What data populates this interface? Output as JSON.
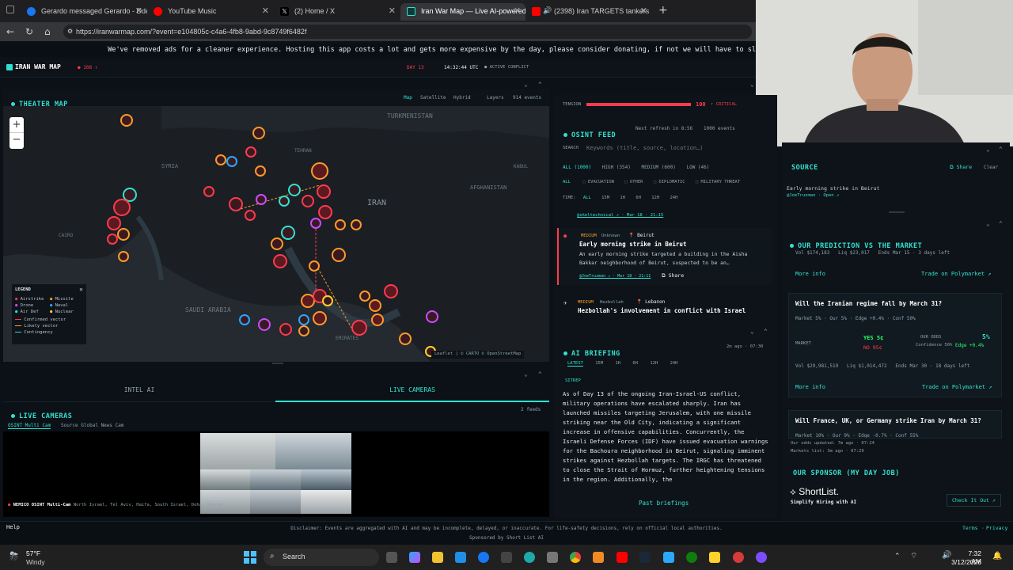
{
  "browser": {
    "tabs": [
      {
        "label": "Gerardo messaged Gerardo - Dde",
        "color": "#1877f2"
      },
      {
        "label": "YouTube Music",
        "color": "#ff0000"
      },
      {
        "label": "(2) Home / X",
        "color": "#e7e9ea"
      },
      {
        "label": "Iran War Map — Live AI-powered",
        "color": "#33e0d0"
      },
      {
        "label": "(2398) Iran TARGETS tankers",
        "color": "#ff0000"
      }
    ],
    "url": "https://iranwarmap.com/?event=e104805c-c4a6-4fb8-9abd-9c8749f6482f"
  },
  "banner": "We've removed ads for a cleaner experience. Hosting this app costs a lot and gets more expensive by the day, please consider donating, if not we will have to sl",
  "header": {
    "logo": "IRAN WAR MAP",
    "count": "108",
    "day": "DAY 13",
    "time": "14:32:44 UTC",
    "status": "ACTIVE CONFLICT"
  },
  "map": {
    "title": "THEATER MAP",
    "view_tabs": [
      "Map",
      "Satellite",
      "Hybrid"
    ],
    "layers": "Layers",
    "events": "914 events",
    "labels": [
      "TURKMENISTAN",
      "SYRIA",
      "IRAN",
      "AFGHANISTAN",
      "SAUDI ARABIA",
      "KABUL",
      "CAIRO",
      "EMIRATES",
      "TEHRAN"
    ],
    "attribution": "Leaflet | © CARTO © OpenStreetMap",
    "zoom_in": "+",
    "zoom_out": "−"
  },
  "legend": {
    "title": "LEGEND",
    "items": [
      {
        "label": "Airstrike",
        "color": "#ff3a4f"
      },
      {
        "label": "Missile",
        "color": "#ff9a2a"
      },
      {
        "label": "Drone",
        "color": "#c94dff"
      },
      {
        "label": "Naval",
        "color": "#2aa8ff"
      },
      {
        "label": "Air Def",
        "color": "#33e0d0"
      },
      {
        "label": "Nuclear",
        "color": "#ffd12a"
      }
    ],
    "vectors": [
      {
        "label": "Confirmed vector",
        "color": "#ff3a4f"
      },
      {
        "label": "Likely vector",
        "color": "#ff9a2a"
      },
      {
        "label": "Contingency",
        "color": "#33e0d0"
      }
    ]
  },
  "tension": {
    "label": "TENSION",
    "value": "100",
    "status": "CRITICAL",
    "level": 1.0
  },
  "feed": {
    "title": "OSINT FEED",
    "refresh": "Next refresh in 8:56",
    "count": "1000 events",
    "search_label": "SEARCH",
    "search_placeholder": "Keywords (title, source, location…)",
    "filters": [
      "ALL (1000)",
      "HIGH (354)",
      "MEDIUM (600)",
      "LOW (46)"
    ],
    "cats": [
      "ALL",
      "EVACUATION",
      "OTHER",
      "DIPLOMATIC",
      "MILITARY THREAT"
    ],
    "time_label": "TIME:",
    "times": [
      "ALL",
      "15M",
      "1H",
      "6H",
      "12H",
      "24H"
    ],
    "prev_meta": "@skeltechnical ↗ · Mar 18 · 21:15",
    "item1": {
      "severity": "MEDIUM",
      "actor": "Unknown",
      "location": "Beirut",
      "title": "Early morning strike in Beirut",
      "body": "An early morning strike targeted a building in the Aisha Bakkar neighborhood of Beirut, suspected to be an…",
      "meta": "@JoeTruzman ↗ · Mar 18 · 21:11",
      "share": "Share"
    },
    "item2": {
      "severity": "MEDIUM",
      "actor": "Hezbollah",
      "location": "Lebanon",
      "title": "Hezbollah's involvement in conflict with Israel"
    }
  },
  "briefing": {
    "title": "AI BRIEFING",
    "updated": "2m ago · 07:30",
    "tabs": [
      "LATEST",
      "15M",
      "1H",
      "6H",
      "12H",
      "24H"
    ],
    "sitrep": "SITREP",
    "text": "As of Day 13 of the ongoing Iran-Israel-US conflict, military operations have escalated sharply. Iran has launched missiles targeting Jerusalem, with one missile striking near the Old City, indicating a significant increase in offensive capabilities. Concurrently, the Israeli Defense Forces (IDF) have issued evacuation warnings for the Bachoura neighborhood in Beirut, signaling imminent strikes against Hezbollah targets. The IRGC has threatened to close the Strait of Hormuz, further heightening tensions in the region. Additionally, the",
    "past": "Past briefings"
  },
  "source": {
    "title": "SOURCE",
    "share": "Share",
    "clear": "Clear",
    "item": "Early morning strike in Beirut",
    "meta": "@JoeTruzman · Open ↗"
  },
  "prediction": {
    "title": "OUR PREDICTION VS THE MARKET",
    "top_stats": "Vol $174,183   Liq $23,017   Ends Mar 15 · 3 days left",
    "more_info": "More info",
    "trade": "Trade on Polymarket ↗",
    "q1": {
      "question": "Will the Iranian regime fall by March 31?",
      "stats": "Market 5% · Our 5% · Edge +0.4% · Conf 50%",
      "market_label": "MARKET",
      "yes": "YES 5¢",
      "no": "NO 95¢",
      "odds_label": "OUR ODDS",
      "odds": "5%",
      "confidence": "Confidence 50%",
      "edge": "Edge +0.4%",
      "footer": "Vol $29,981,519   Liq $1,014,472   Ends Mar 30 · 18 days left"
    },
    "q2": {
      "question": "Will France, UK, or Germany strike Iran by March 31?",
      "stats": "Market 10% · Our 9% · Edge -0.7% · Conf 55%"
    },
    "updated1": "Our odds updated: 7m ago · 07:24",
    "updated2": "Markets list: 3m ago · 07:29"
  },
  "sponsor": {
    "title": "OUR SPONSOR (MY DAY JOB)",
    "name": "ShortList.",
    "tagline": "Simplify Hiring with AI",
    "cta": "Check It Out ↗"
  },
  "bottom": {
    "tabs": [
      "INTEL AI",
      "LIVE CAMERAS"
    ],
    "cams_title": "LIVE CAMERAS",
    "feeds": "2 feeds",
    "cam_tabs": [
      "OSINT Multi Cam",
      "Source Global News Cam"
    ],
    "cam_caption": "NEMICO OSINT Multi-Cam",
    "cam_locations": "North Israel, Tel Aviv, Haifa, South Israel, Doha, Beirut"
  },
  "footer": {
    "help": "Help",
    "disclaimer": "Disclaimer: Events are aggregated with AI and may be incomplete, delayed, or inaccurate. For life-safety decisions, rely on official local authorities.",
    "sponsored": "Sponsored by Short List AI",
    "terms": "Terms",
    "privacy": "Privacy"
  },
  "taskbar": {
    "weather_temp": "57°F",
    "weather_desc": "Windy",
    "search": "Search",
    "time": "7:32 AM",
    "date": "3/12/2026"
  }
}
